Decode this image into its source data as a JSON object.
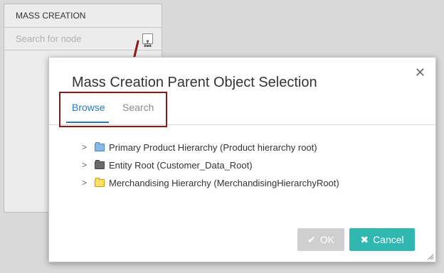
{
  "background": {
    "panel_title": "MASS CREATION",
    "search_placeholder": "Search for node"
  },
  "dialog": {
    "title": "Mass Creation Parent Object Selection",
    "tabs": [
      {
        "label": "Browse",
        "active": true
      },
      {
        "label": "Search",
        "active": false
      }
    ],
    "tree": [
      {
        "label": "Primary Product Hierarchy (Product hierarchy root)",
        "folder_color": "#6fa8dc"
      },
      {
        "label": "Entity Root (Customer_Data_Root)",
        "folder_color": "#6b6b6b"
      },
      {
        "label": "Merchandising Hierarchy (MerchandisingHierarchyRoot)",
        "folder_color": "#ffd966"
      }
    ],
    "buttons": {
      "ok": "OK",
      "cancel": "Cancel"
    }
  },
  "colors": {
    "accent": "#2d7ab8",
    "cancel_bg": "#30b7b0",
    "ok_disabled_bg": "#cfcfcf",
    "annotation": "#8b1a1a"
  },
  "icons": {
    "close": "close-icon",
    "tree_view": "tree-view-icon",
    "chevron": "chevron-right-icon",
    "check": "check-icon",
    "x": "x-icon",
    "resize": "resize-grip-icon"
  }
}
